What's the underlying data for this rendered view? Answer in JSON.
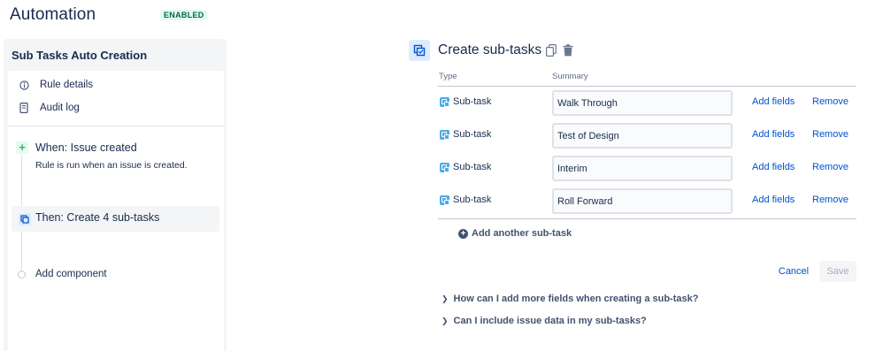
{
  "header": {
    "title": "Automation",
    "status": "ENABLED"
  },
  "sidebar": {
    "rule_name": "Sub Tasks Auto Creation",
    "nav": [
      {
        "label": "Rule details",
        "icon": "info-icon"
      },
      {
        "label": "Audit log",
        "icon": "audit-log-icon"
      }
    ],
    "trigger": {
      "title": "When: Issue created",
      "description": "Rule is run when an issue is created."
    },
    "action": {
      "title": "Then: Create 4 sub-tasks"
    },
    "add_component": "Add component"
  },
  "component": {
    "title": "Create sub-tasks",
    "columns": {
      "type": "Type",
      "summary": "Summary"
    },
    "rows": [
      {
        "type": "Sub-task",
        "summary": "Walk Through",
        "add_fields": "Add fields",
        "remove": "Remove"
      },
      {
        "type": "Sub-task",
        "summary": "Test of Design",
        "add_fields": "Add fields",
        "remove": "Remove"
      },
      {
        "type": "Sub-task",
        "summary": "Interim",
        "add_fields": "Add fields",
        "remove": "Remove"
      },
      {
        "type": "Sub-task",
        "summary": "Roll Forward",
        "add_fields": "Add fields",
        "remove": "Remove"
      }
    ],
    "add_subtask": "Add another sub-task",
    "cancel": "Cancel",
    "save": "Save",
    "faqs": [
      "How can I add more fields when creating a sub-task?",
      "Can I include issue data in my sub-tasks?"
    ]
  },
  "colors": {
    "accent": "#0052cc",
    "enabled_badge": "#006644",
    "subtask_icon": "#4bade8"
  }
}
